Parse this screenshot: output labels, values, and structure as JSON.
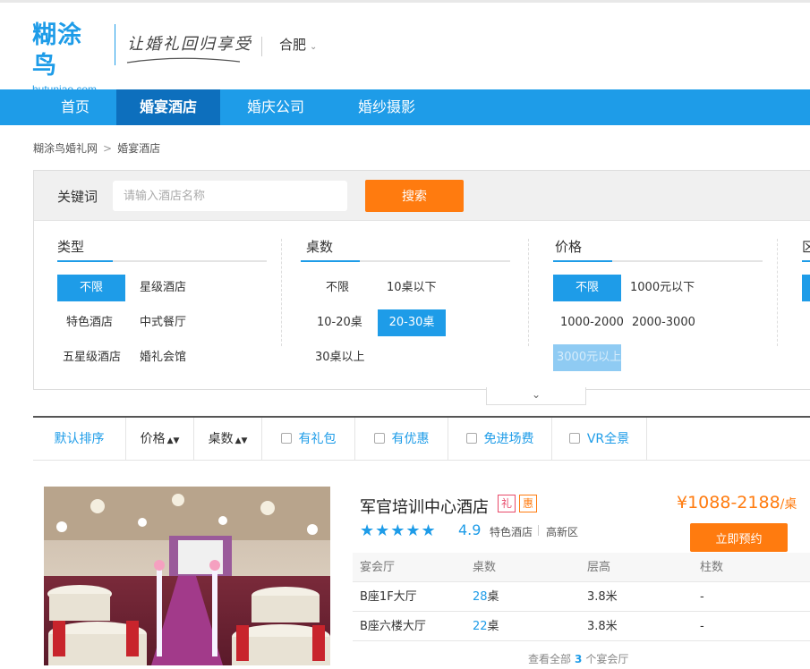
{
  "header": {
    "logo_text_main": "糊涂鸟",
    "logo_url": "hutuniao.com",
    "slogan": "让婚礼回归享受",
    "city": "合肥",
    "city_caret": "⌄"
  },
  "nav": {
    "items": [
      {
        "label": "首页"
      },
      {
        "label": "婚宴酒店",
        "active": true
      },
      {
        "label": "婚庆公司"
      },
      {
        "label": "婚纱摄影"
      }
    ]
  },
  "breadcrumb": {
    "home": "糊涂鸟婚礼网",
    "separator": ">",
    "current": "婚宴酒店"
  },
  "search": {
    "label": "关键词",
    "placeholder": "请输入酒店名称",
    "button": "搜索"
  },
  "filters": {
    "type": {
      "title": "类型",
      "options": [
        "不限",
        "星级酒店",
        "特色酒店",
        "中式餐厅",
        "五星级酒店",
        "婚礼会馆"
      ],
      "selected": "不限"
    },
    "tables": {
      "title": "桌数",
      "options": [
        "不限",
        "10桌以下",
        "10-20桌",
        "20-30桌",
        "30桌以上"
      ],
      "selected": "20-30桌"
    },
    "price": {
      "title": "价格",
      "options": [
        "不限",
        "1000元以下",
        "1000-2000",
        "2000-3000",
        "3000元以上"
      ],
      "selected": "不限",
      "disabled": "3000元以上"
    },
    "district": {
      "title": "区"
    },
    "expand_icon": "⌄"
  },
  "sortbar": {
    "default": "默认排序",
    "price": "价格",
    "tables": "桌数",
    "arrows": "▲▼",
    "checks": [
      "有礼包",
      "有优惠",
      "免进场费",
      "VR全景"
    ]
  },
  "hotel": {
    "name": "军官培训中心酒店",
    "tag_gift": "礼",
    "tag_discount": "惠",
    "stars": "★★★★★",
    "rating": "4.9",
    "type": "特色酒店",
    "district": "高新区",
    "price_prefix": "¥",
    "price": "1088-2188",
    "price_unit": "/桌",
    "book_button": "立即预约",
    "table_headers": [
      "宴会厅",
      "桌数",
      "层高",
      "柱数"
    ],
    "halls": [
      {
        "name": "B座1F大厅",
        "tables": "28",
        "unit": "桌",
        "height": "3.8米",
        "pillars": "-"
      },
      {
        "name": "B座六楼大厅",
        "tables": "22",
        "unit": "桌",
        "height": "3.8米",
        "pillars": "-"
      }
    ],
    "view_all_prefix": "查看全部",
    "view_all_count": "3",
    "view_all_suffix": "个宴会厅"
  },
  "colors": {
    "brand_blue": "#1e9ce8",
    "nav_active": "#0d6fbd",
    "accent_orange": "#ff7b0f"
  }
}
